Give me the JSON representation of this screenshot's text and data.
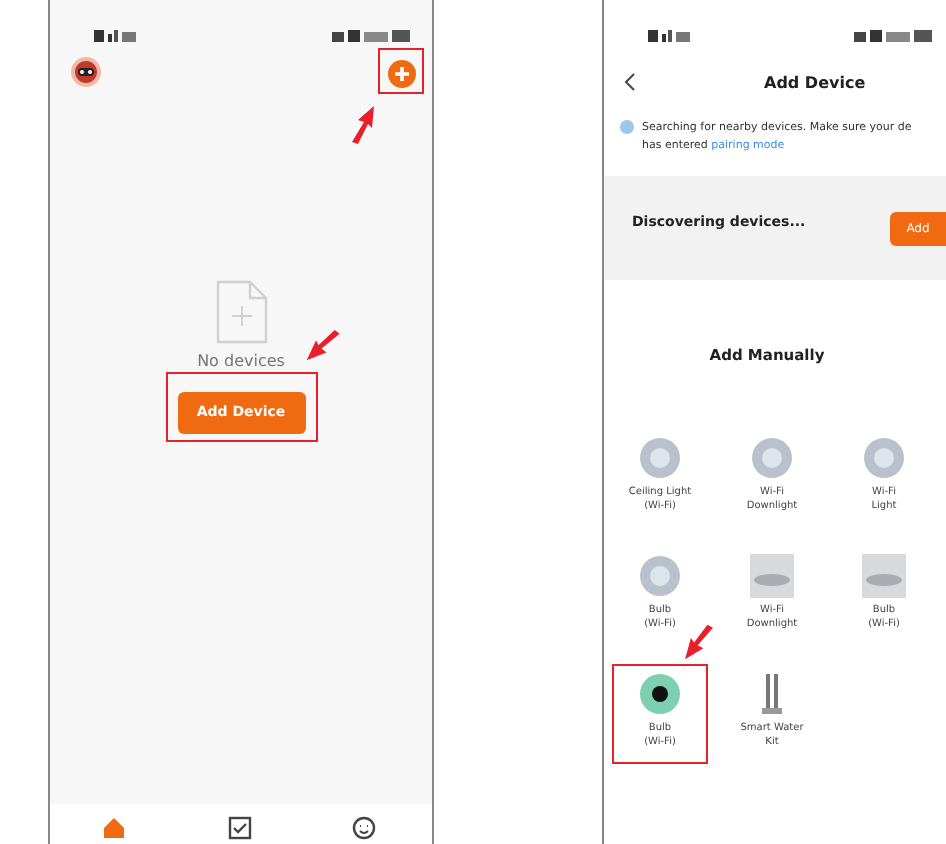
{
  "home_screen": {
    "empty_text": "No devices",
    "add_button": "Add Device",
    "callout_add_icon": true,
    "callout_add_button": true,
    "nav": [
      {
        "kind": "home",
        "selected": true
      },
      {
        "kind": "tasks",
        "selected": false
      },
      {
        "kind": "profile",
        "selected": false
      }
    ]
  },
  "add_screen": {
    "title": "Add Device",
    "notice": "Searching for nearby devices. Make sure your de",
    "notice_line2": "has entered",
    "notice_link": "pairing mode",
    "discovering": "Discovering devices...",
    "discover_button": "Add",
    "section_title": "Add Manually",
    "devices": [
      {
        "kind": "round",
        "name": "Ceiling Light",
        "sub": "(Wi-Fi)",
        "highlighted": false
      },
      {
        "kind": "round",
        "name": "Wi-Fi",
        "sub": "Downlight",
        "highlighted": false
      },
      {
        "kind": "round",
        "name": "Wi-Fi",
        "sub": "Light",
        "highlighted": false
      },
      {
        "kind": "round",
        "name": "Bulb",
        "sub": "(Wi-Fi)",
        "highlighted": false
      },
      {
        "kind": "flat",
        "name": "Wi-Fi",
        "sub": "Downlight",
        "highlighted": false
      },
      {
        "kind": "flat",
        "name": "Bulb",
        "sub": "(Wi-Fi)",
        "highlighted": false
      },
      {
        "kind": "eye",
        "name": "Bulb",
        "sub": "(Wi-Fi)",
        "highlighted": true
      },
      {
        "kind": "tube",
        "name": "Smart Water",
        "sub": "Kit",
        "highlighted": false
      }
    ]
  }
}
